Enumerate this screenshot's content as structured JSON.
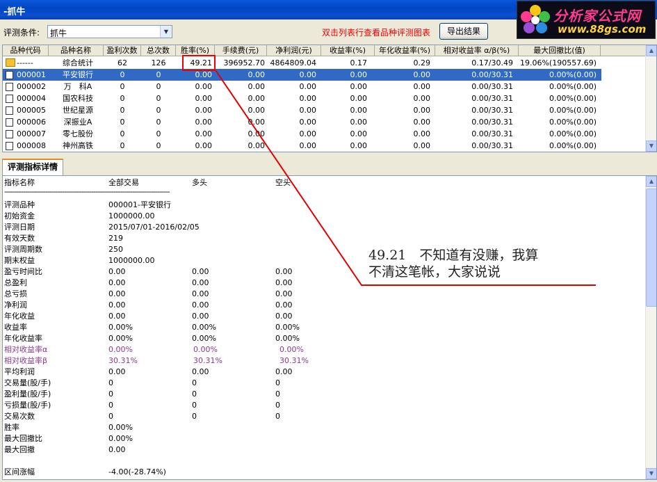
{
  "window": {
    "title": "-抓牛"
  },
  "logo": {
    "text_cn": "分析家公式网",
    "text_url": "www.88gs.com",
    "primary_color": "#ff3b8e",
    "secondary_color": "#ffd23a"
  },
  "toolbar": {
    "condition_label": "评测条件:",
    "condition_value": "抓牛",
    "hint": "双击列表行查看品种评测图表",
    "export_label": "导出结果"
  },
  "grid": {
    "headers": [
      "品种代码",
      "品种名称",
      "盈利次数",
      "总次数",
      "胜率(%)",
      "手续费(元)",
      "净利润(元)",
      "收益率(%)",
      "年化收益率(%)",
      "相对收益率 α/β(%)",
      "最大回撤比(值)"
    ],
    "rows": [
      {
        "icon": "folder-icon",
        "code": "------",
        "name": "综合统计",
        "win": "62",
        "total": "126",
        "rate": "49.21",
        "fee": "396952.70",
        "profit": "4864809.04",
        "ret": "0.17",
        "annual": "0.29",
        "relative": "0.17/30.49",
        "drawdown": "19.06%(190557.69)"
      },
      {
        "icon": "document-icon",
        "code": "000001",
        "name": "平安银行",
        "win": "0",
        "total": "0",
        "rate": "0.00",
        "fee": "0.00",
        "profit": "0.00",
        "ret": "0.00",
        "annual": "0.00",
        "relative": "0.00/30.31",
        "drawdown": "0.00%(0.00)",
        "selected": true
      },
      {
        "icon": "document-icon",
        "code": "000002",
        "name": "万　科A",
        "win": "0",
        "total": "0",
        "rate": "0.00",
        "fee": "0.00",
        "profit": "0.00",
        "ret": "0.00",
        "annual": "0.00",
        "relative": "0.00/30.31",
        "drawdown": "0.00%(0.00)"
      },
      {
        "icon": "document-icon",
        "code": "000004",
        "name": "国农科技",
        "win": "0",
        "total": "0",
        "rate": "0.00",
        "fee": "0.00",
        "profit": "0.00",
        "ret": "0.00",
        "annual": "0.00",
        "relative": "0.00/30.31",
        "drawdown": "0.00%(0.00)"
      },
      {
        "icon": "document-icon",
        "code": "000005",
        "name": "世纪星源",
        "win": "0",
        "total": "0",
        "rate": "0.00",
        "fee": "0.00",
        "profit": "0.00",
        "ret": "0.00",
        "annual": "0.00",
        "relative": "0.00/30.31",
        "drawdown": "0.00%(0.00)"
      },
      {
        "icon": "document-icon",
        "code": "000006",
        "name": "深振业A",
        "win": "0",
        "total": "0",
        "rate": "0.00",
        "fee": "0.00",
        "profit": "0.00",
        "ret": "0.00",
        "annual": "0.00",
        "relative": "0.00/30.31",
        "drawdown": "0.00%(0.00)"
      },
      {
        "icon": "document-icon",
        "code": "000007",
        "name": "零七股份",
        "win": "0",
        "total": "0",
        "rate": "0.00",
        "fee": "0.00",
        "profit": "0.00",
        "ret": "0.00",
        "annual": "0.00",
        "relative": "0.00/30.31",
        "drawdown": "0.00%(0.00)"
      },
      {
        "icon": "document-icon",
        "code": "000008",
        "name": "神州高铁",
        "win": "0",
        "total": "0",
        "rate": "0.00",
        "fee": "0.00",
        "profit": "0.00",
        "ret": "0.00",
        "annual": "0.00",
        "relative": "0.00/30.31",
        "drawdown": "0.00%(0.00)"
      }
    ]
  },
  "tab": {
    "label": "评测指标详情"
  },
  "detail": {
    "headers": [
      "指标名称",
      "全部交易",
      "多头",
      "空头"
    ],
    "separator": "--------------------------------------------------------------------------------",
    "rows": [
      {
        "k": "评测品种",
        "a": "000001-平安银行",
        "b": "",
        "c": ""
      },
      {
        "k": "初始资金",
        "a": "1000000.00",
        "b": "",
        "c": ""
      },
      {
        "k": "评测日期",
        "a": "2015/07/01-2016/02/05",
        "b": "",
        "c": ""
      },
      {
        "k": "有效天数",
        "a": "219",
        "b": "",
        "c": ""
      },
      {
        "k": "评测周期数",
        "a": "250",
        "b": "",
        "c": ""
      },
      {
        "k": "期末权益",
        "a": "1000000.00",
        "b": "",
        "c": ""
      },
      {
        "k": "盈亏时间比",
        "a": "0.00",
        "b": "0.00",
        "c": "0.00"
      },
      {
        "k": "总盈利",
        "a": "0.00",
        "b": "0.00",
        "c": "0.00"
      },
      {
        "k": "总亏损",
        "a": "0.00",
        "b": "0.00",
        "c": "0.00"
      },
      {
        "k": "净利润",
        "a": "0.00",
        "b": "0.00",
        "c": "0.00"
      },
      {
        "k": "年化收益",
        "a": "0.00",
        "b": "0.00",
        "c": "0.00"
      },
      {
        "k": "收益率",
        "a": "0.00%",
        "b": "0.00%",
        "c": "0.00%"
      },
      {
        "k": "年化收益率",
        "a": "0.00%",
        "b": "0.00%",
        "c": "0.00%"
      },
      {
        "k": "相对收益率α",
        "a": "0.00%",
        "b": "0.00%",
        "c": "0.00%",
        "purple": true
      },
      {
        "k": "相对收益率β",
        "a": "30.31%",
        "b": "30.31%",
        "c": "30.31%",
        "purple": true
      },
      {
        "k": "平均利润",
        "a": "0.00",
        "b": "0.00",
        "c": "0.00"
      },
      {
        "k": "交易量(股/手)",
        "a": "0",
        "b": "0",
        "c": "0"
      },
      {
        "k": "盈利量(股/手)",
        "a": "0",
        "b": "0",
        "c": "0"
      },
      {
        "k": "亏损量(股/手)",
        "a": "0",
        "b": "0",
        "c": "0"
      },
      {
        "k": "交易次数",
        "a": "0",
        "b": "0",
        "c": "0"
      },
      {
        "k": "胜率",
        "a": "0.00%",
        "b": "",
        "c": ""
      },
      {
        "k": "最大回撤比",
        "a": "0.00%",
        "b": "",
        "c": ""
      },
      {
        "k": "最大回撤",
        "a": "0.00",
        "b": "",
        "c": ""
      },
      {
        "k": "",
        "a": "",
        "b": "",
        "c": ""
      },
      {
        "k": "区间涨幅",
        "a": "-4.00(-28.74%)",
        "b": "",
        "c": ""
      }
    ]
  },
  "annotation": {
    "line1": "49.21　不知道有没赚，我算",
    "line2": "不清这笔帐，大家说说",
    "color": "#e00000"
  }
}
